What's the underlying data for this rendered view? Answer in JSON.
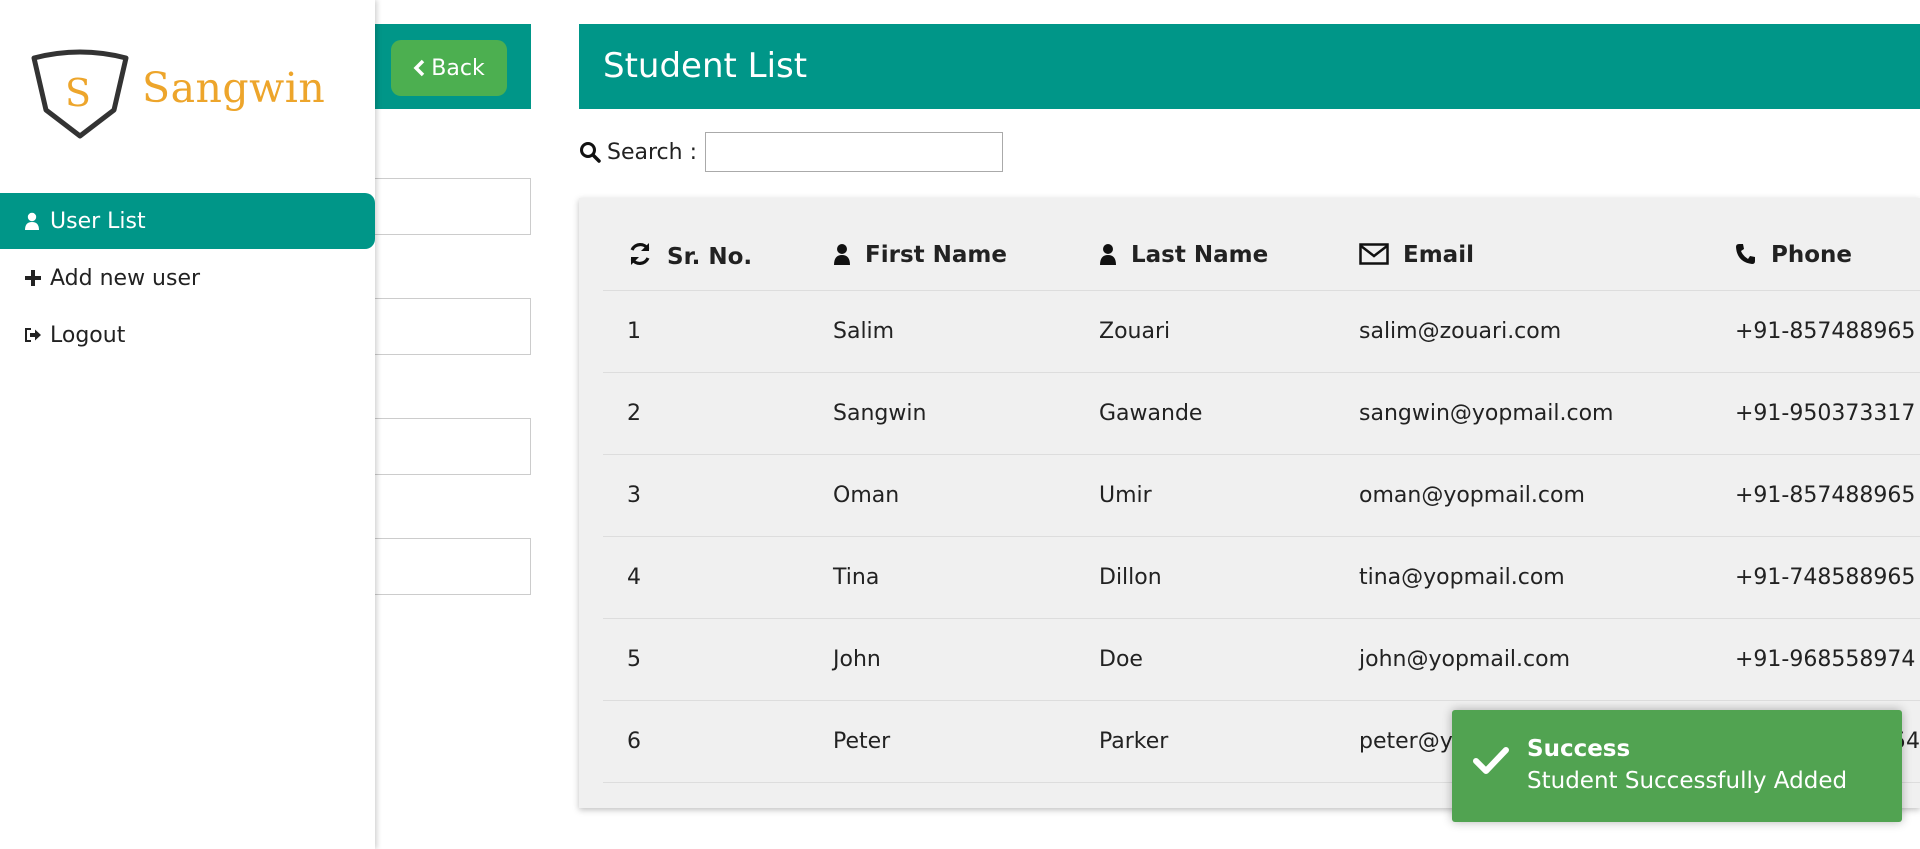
{
  "brand": {
    "name": "Sangwin",
    "monogram": "S"
  },
  "sidebar": {
    "items": [
      {
        "label": "User List",
        "icon": "user-icon",
        "active": true
      },
      {
        "label": "Add new user",
        "icon": "plus-icon",
        "active": false
      },
      {
        "label": "Logout",
        "icon": "sign-out-icon",
        "active": false
      }
    ]
  },
  "form": {
    "back_label": "Back"
  },
  "main": {
    "title": "Student List"
  },
  "search": {
    "label": "Search :",
    "value": ""
  },
  "table": {
    "headers": [
      "Sr. No.",
      "First Name",
      "Last Name",
      "Email",
      "Phone"
    ],
    "rows": [
      [
        "1",
        "Salim",
        "Zouari",
        "salim@zouari.com",
        "+91-857488965"
      ],
      [
        "2",
        "Sangwin",
        "Gawande",
        "sangwin@yopmail.com",
        "+91-950373317"
      ],
      [
        "3",
        "Oman",
        "Umir",
        "oman@yopmail.com",
        "+91-857488965"
      ],
      [
        "4",
        "Tina",
        "Dillon",
        "tina@yopmail.com",
        "+91-748588965"
      ],
      [
        "5",
        "John",
        "Doe",
        "john@yopmail.com",
        "+91-968558974"
      ],
      [
        "6",
        "Peter",
        "Parker",
        "peter@y",
        "54"
      ]
    ]
  },
  "toast": {
    "title": "Success",
    "message": "Student Successfully Added",
    "color": "#51a351"
  },
  "colors": {
    "primary": "#009688",
    "back_button": "#4caf50",
    "brand_orange": "#eda52b"
  }
}
